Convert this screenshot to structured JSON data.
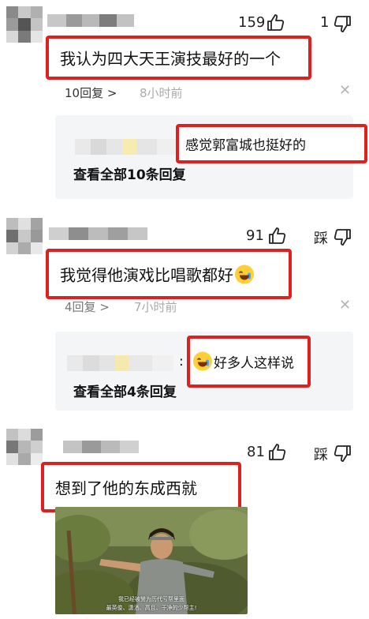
{
  "comments": [
    {
      "likes": "159",
      "dislikes": "1",
      "text": "我认为四大天王演技最好的一个",
      "reply_count": "10回复 >",
      "time": "8小时前",
      "reply_preview": "感觉郭富城也挺好的",
      "view_all": "查看全部10条回复"
    },
    {
      "likes": "91",
      "dislike_label": "踩",
      "text": "我觉得他演戏比唱歌都好",
      "reply_count": "4回复 >",
      "time": "7小时前",
      "reply_preview": "好多人这样说",
      "reply_prefix": ":",
      "view_all": "查看全部4条回复"
    },
    {
      "likes": "81",
      "dislike_label": "踩",
      "text": "想到了他的东成西就",
      "subtitle_1": "我已经被誉为历代亏帮里面",
      "subtitle_2": "最英俊、潇洒、高且、干净的少帮主!"
    }
  ],
  "icons": {
    "like": "thumbs-up-icon",
    "dislike": "thumbs-down-icon",
    "close": "close-icon",
    "emoji": "laughing-crying-emoji-icon"
  },
  "colors": {
    "highlight": "#e0201f",
    "panel": "#f4f5f7",
    "muted": "#aaaaaa"
  }
}
